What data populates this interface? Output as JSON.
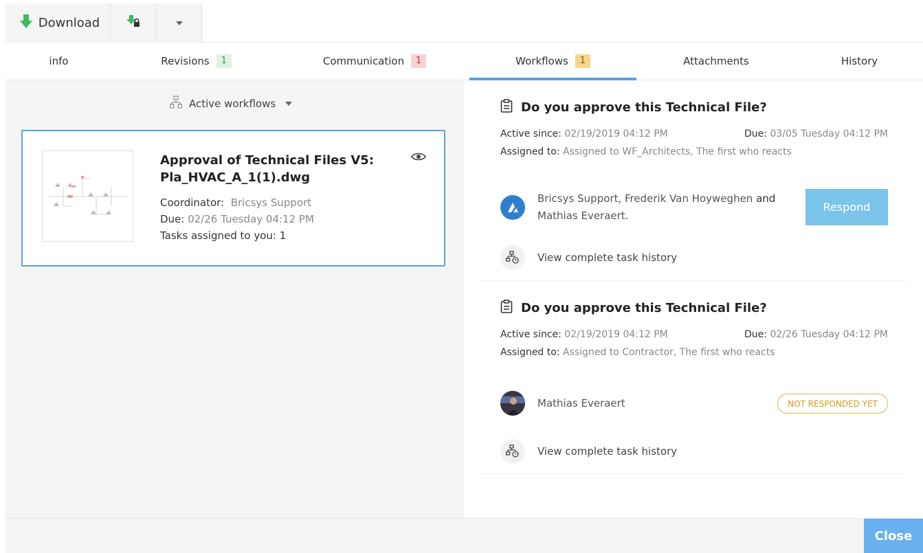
{
  "toolbar": {
    "download_label": "Download",
    "download_icon": "download-arrow-icon",
    "secure_download_icon": "download-lock-icon",
    "more_icon": "caret-down-icon"
  },
  "tabs": [
    {
      "label": "info",
      "badge": ""
    },
    {
      "label": "Revisions",
      "badge": "1",
      "badge_color": "#dff2e3"
    },
    {
      "label": "Communication",
      "badge": "1",
      "badge_color": "#f6d2d4"
    },
    {
      "label": "Workflows",
      "badge": "1",
      "badge_color": "#f8d68a",
      "active": true
    },
    {
      "label": "Attachments",
      "badge": ""
    },
    {
      "label": "History",
      "badge": ""
    }
  ],
  "left": {
    "filter_label": "Active workflows",
    "card": {
      "title": "Approval of Technical Files V5: Pla_HVAC_A_1(1).dwg",
      "coordinator_label": "Coordinator:",
      "coordinator_value": "Bricsys Support",
      "due_label": "Due:",
      "due_value": "02/26 Tuesday 04:12 PM",
      "tasks_label": "Tasks assigned to you: 1"
    }
  },
  "tasks": [
    {
      "title": "Do you approve this Technical File?",
      "active_since_label": "Active since:",
      "active_since_value": "02/19/2019 04:12 PM",
      "due_label": "Due:",
      "due_value": "03/05 Tuesday 04:12 PM",
      "assigned_label": "Assigned to:",
      "assigned_value": "Assigned to WF_Architects, The first who reacts",
      "assignee_1": "Bricsys Support",
      "assignee_sep_1": ",",
      "assignee_2": "Frederik Van Hoyweghen",
      "assignee_and": "and",
      "assignee_3": "Mathias Everaert.",
      "action_label": "Respond",
      "history_label": "View complete task history"
    },
    {
      "title": "Do you approve this Technical File?",
      "active_since_label": "Active since:",
      "active_since_value": "02/19/2019 04:12 PM",
      "due_label": "Due:",
      "due_value": "02/26 Tuesday 04:12 PM",
      "assigned_label": "Assigned to:",
      "assigned_value": "Assigned to Contractor, The first who reacts",
      "assignee_1": "Mathias Everaert",
      "status_label": "NOT RESPONDED YET",
      "history_label": "View complete task history"
    }
  ],
  "footer": {
    "close_label": "Close"
  },
  "colors": {
    "accent": "#5aa0e0",
    "respond_button": "#7bc4ea",
    "close_button": "#6ab1ef",
    "status_pending": "#e6b34a",
    "download_icon": "#3fb95c"
  }
}
